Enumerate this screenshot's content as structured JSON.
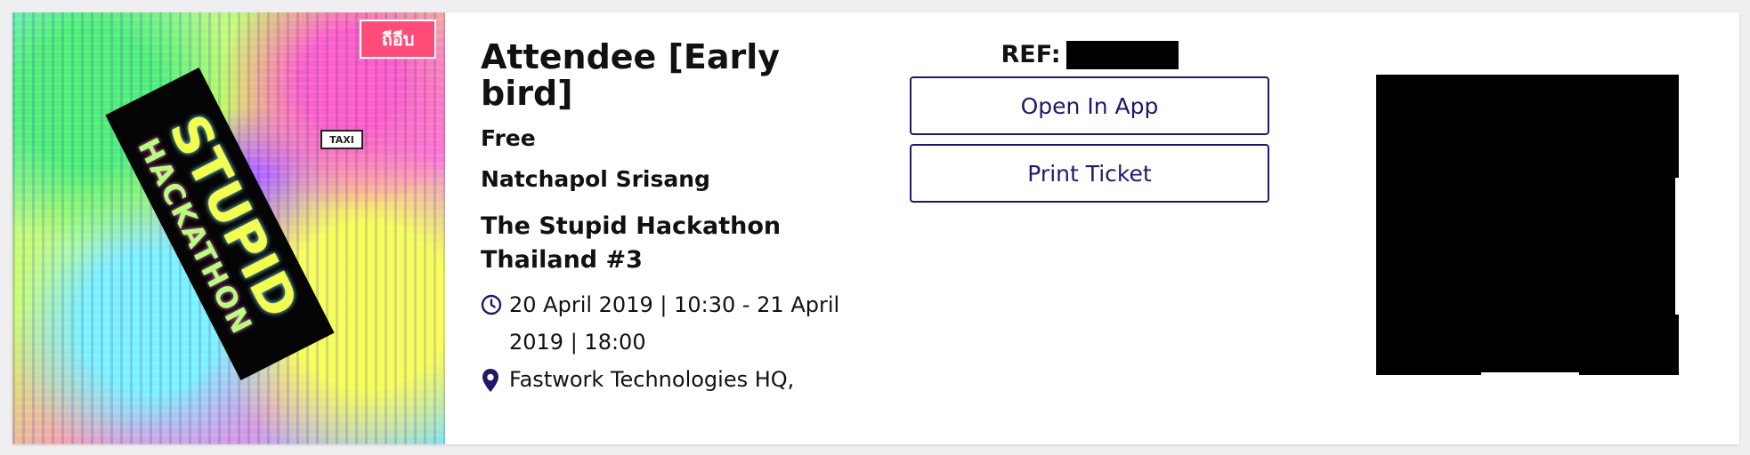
{
  "event_image": {
    "banner_line_1": "STUPID",
    "banner_line_2": "HACKATHON",
    "sign_text": "ถีอีบ",
    "taxi_text": "TAXI"
  },
  "ticket": {
    "type": "Attendee [Early bird]",
    "price": "Free",
    "attendee_name": "Natchapol Srisang",
    "event_name": "The Stupid Hackathon Thailand #3",
    "datetime": "20 April 2019 | 10:30 - 21 April 2019 | 18:00",
    "location": "Fastwork Technologies HQ,"
  },
  "actions": {
    "ref_label": "REF:",
    "open_in_app": "Open In App",
    "print_ticket": "Print Ticket"
  },
  "icons": {
    "clock": "clock-icon",
    "location": "map-pin-icon"
  },
  "colors": {
    "accent": "#231768",
    "page_background": "#efeff1",
    "card_background": "#ffffff",
    "redaction": "#000000"
  }
}
